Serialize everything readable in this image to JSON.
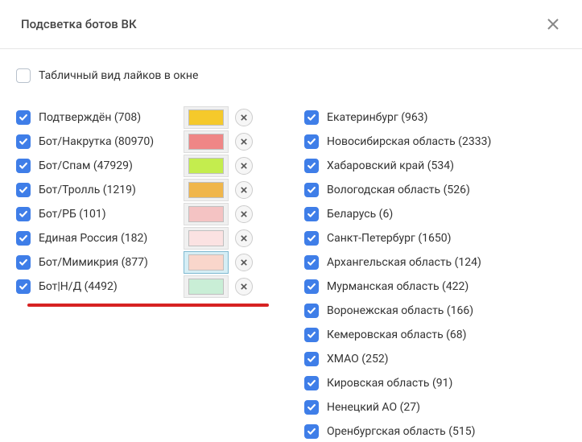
{
  "header": {
    "title": "Подсветка ботов ВК"
  },
  "topOption": {
    "label": "Табличный вид лайков в окне",
    "checked": false
  },
  "categories": [
    {
      "name": "Подтверждён",
      "count": 708,
      "color": "#f5c92b",
      "checked": true,
      "active": false
    },
    {
      "name": "Бот/Накрутка",
      "count": 80970,
      "color": "#ef8686",
      "checked": true,
      "active": false
    },
    {
      "name": "Бот/Спам",
      "count": 47929,
      "color": "#c4ed4e",
      "checked": true,
      "active": false
    },
    {
      "name": "Бот/Тролль",
      "count": 1219,
      "color": "#f0b64b",
      "checked": true,
      "active": false
    },
    {
      "name": "Бот/РБ",
      "count": 101,
      "color": "#f4c3c3",
      "checked": true,
      "active": false
    },
    {
      "name": "Единая Россия",
      "count": 182,
      "color": "#fbe2e2",
      "checked": true,
      "active": false
    },
    {
      "name": "Бот/Мимикрия",
      "count": 877,
      "color": "#f9d6cb",
      "checked": true,
      "active": true
    },
    {
      "name": "Бот|Н/Д",
      "count": 4492,
      "color": "#c9eed6",
      "checked": true,
      "active": false
    }
  ],
  "regions": [
    {
      "name": "Екатеринбург",
      "count": 963,
      "checked": true
    },
    {
      "name": "Новосибирская область",
      "count": 2333,
      "checked": true
    },
    {
      "name": "Хабаровский край",
      "count": 534,
      "checked": true
    },
    {
      "name": "Вологодская область",
      "count": 526,
      "checked": true
    },
    {
      "name": "Беларусь",
      "count": 6,
      "checked": true
    },
    {
      "name": "Санкт-Петербург",
      "count": 1650,
      "checked": true
    },
    {
      "name": "Архангельская область",
      "count": 124,
      "checked": true
    },
    {
      "name": "Мурманская область",
      "count": 422,
      "checked": true
    },
    {
      "name": "Воронежская область",
      "count": 166,
      "checked": true
    },
    {
      "name": "Кемеровская область",
      "count": 68,
      "checked": true
    },
    {
      "name": "ХМАО",
      "count": 252,
      "checked": true
    },
    {
      "name": "Кировская область",
      "count": 91,
      "checked": true
    },
    {
      "name": "Ненецкий АО",
      "count": 27,
      "checked": true
    },
    {
      "name": "Оренбургская область",
      "count": 515,
      "checked": true
    }
  ]
}
